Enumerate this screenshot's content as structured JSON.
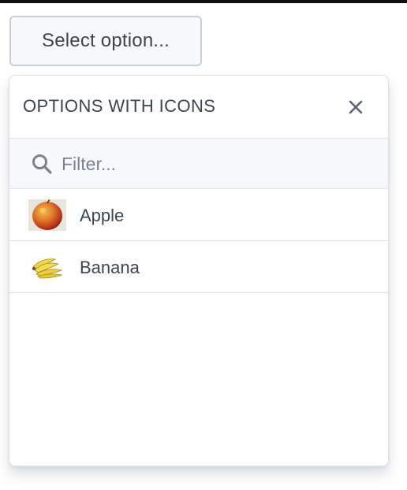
{
  "select": {
    "button_label": "Select option..."
  },
  "dropdown": {
    "title": "OPTIONS WITH ICONS",
    "close_icon": "close-icon",
    "filter": {
      "icon": "search-icon",
      "placeholder": "Filter...",
      "value": ""
    },
    "options": [
      {
        "label": "Apple",
        "icon": "apple-icon"
      },
      {
        "label": "Banana",
        "icon": "banana-icon"
      }
    ]
  },
  "colors": {
    "text": "#3d4451",
    "placeholder": "#7a828f",
    "border": "#dfe2e7",
    "button_bg": "#f6f8fa",
    "filter_bg": "#f6f8fb"
  }
}
